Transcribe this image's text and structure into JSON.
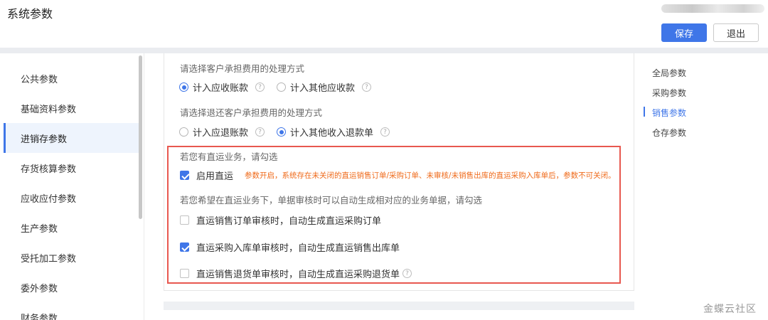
{
  "header": {
    "title": "系统参数"
  },
  "toolbar": {
    "save_label": "保存",
    "exit_label": "退出"
  },
  "left_nav": {
    "items": [
      {
        "label": "公共参数",
        "active": false
      },
      {
        "label": "基础资料参数",
        "active": false
      },
      {
        "label": "进销存参数",
        "active": true
      },
      {
        "label": "存货核算参数",
        "active": false
      },
      {
        "label": "应收应付参数",
        "active": false
      },
      {
        "label": "生产参数",
        "active": false
      },
      {
        "label": "受托加工参数",
        "active": false
      },
      {
        "label": "委外参数",
        "active": false
      },
      {
        "label": "财务参数",
        "active": false
      }
    ]
  },
  "content": {
    "customer_fee": {
      "label": "请选择客户承担费用的处理方式",
      "options": [
        {
          "label": "计入应收账款",
          "selected": true
        },
        {
          "label": "计入其他应收款",
          "selected": false
        }
      ]
    },
    "refund_fee": {
      "label": "请选择退还客户承担费用的处理方式",
      "options": [
        {
          "label": "计入应退账款",
          "selected": false
        },
        {
          "label": "计入其他收入退款单",
          "selected": true
        }
      ]
    },
    "direct_shipping": {
      "intro": "若您有直运业务，请勾选",
      "enable": {
        "label": "启用直运",
        "checked": true
      },
      "warning": "参数开启，系统存在未关闭的直运销售订单/采购订单、未审核/未销售出库的直运采购入库单后，参数不可关闭。",
      "auto_intro": "若您希望在直运业务下，单据审核时可以自动生成相对应的业务单据，请勾选",
      "auto_options": [
        {
          "label": "直运销售订单审核时，自动生成直运采购订单",
          "checked": false
        },
        {
          "label": "直运采购入库单审核时，自动生成直运销售出库单",
          "checked": true
        },
        {
          "label": "直运销售退货单审核时，自动生成直运采购退货单",
          "checked": false
        }
      ]
    },
    "help_glyph": "?"
  },
  "anchor_nav": {
    "items": [
      {
        "label": "全局参数",
        "active": false
      },
      {
        "label": "采购参数",
        "active": false
      },
      {
        "label": "销售参数",
        "active": true
      },
      {
        "label": "仓存参数",
        "active": false
      }
    ]
  },
  "watermark": "金蝶云社区",
  "colors": {
    "accent": "#3f76e8",
    "warning": "#ef6a1a",
    "highlight_border": "#e8584f"
  }
}
